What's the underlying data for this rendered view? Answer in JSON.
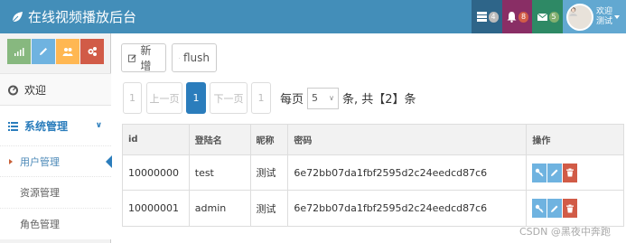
{
  "navbar": {
    "brand": "在线视频播放后台",
    "tasks_count": "4",
    "alerts_count": "8",
    "messages_count": "5",
    "user_greeting": "欢迎",
    "user_name": "测试"
  },
  "sidebar": {
    "shortcuts": [
      "signal-icon",
      "pencil-icon",
      "users-icon",
      "cogs-icon"
    ],
    "welcome_label": "欢迎",
    "system_label": "系统管理",
    "submenu": [
      "用户管理",
      "资源管理",
      "角色管理"
    ]
  },
  "toolbar": {
    "add_label": "新增",
    "flush_label": "flush"
  },
  "pagination": {
    "first": "1",
    "prev": "上一页",
    "current": "1",
    "next": "下一页",
    "last": "1",
    "per_page_prefix": "每页",
    "per_page_value": "5",
    "per_page_suffix": "条, 共【2】条"
  },
  "table": {
    "headers": [
      "id",
      "登陆名",
      "昵称",
      "密码",
      "操作"
    ],
    "rows": [
      {
        "id": "10000000",
        "login": "test",
        "nick": "测试",
        "password": "6e72bb07da1fbf2595d2c24eedcd87c6"
      },
      {
        "id": "10000001",
        "login": "admin",
        "nick": "测试",
        "password": "6e72bb07da1fbf2595d2c24eedcd87c6"
      }
    ]
  },
  "watermark": "CSDN @黑夜中奔跑",
  "colors": {
    "navbar": "#438eb9",
    "accent": "#2b7dbc",
    "danger": "#d15b47"
  }
}
